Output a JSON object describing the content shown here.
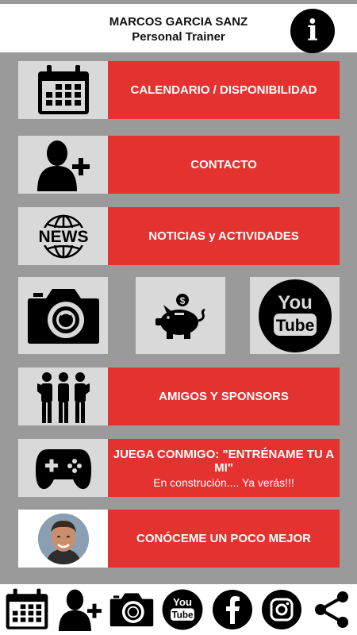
{
  "header": {
    "name": "MARCOS GARCIA SANZ",
    "role": "Personal Trainer"
  },
  "menu": {
    "calendar": "CALENDARIO / DISPONIBILIDAD",
    "contact": "CONTACTO",
    "news": "NOTICIAS y ACTIVIDADES",
    "news_icon_text": "NEWS",
    "friends": "AMIGOS Y SPONSORS",
    "game_title": "JUEGA CONMIGO: \"ENTRÉNAME TU A MI\"",
    "game_sub": "En construción.... Ya verás!!!",
    "about": "CONÓCEME UN POCO MEJOR"
  },
  "youtube": {
    "you": "You",
    "tube": "Tube"
  },
  "colors": {
    "accent": "#e3322f",
    "tile": "#d9d9d9",
    "background": "#9a9a9a"
  },
  "icons": [
    "info-icon",
    "calendar-icon",
    "add-contact-icon",
    "news-globe-icon",
    "camera-icon",
    "piggy-bank-icon",
    "youtube-icon",
    "friends-icon",
    "gamepad-icon",
    "avatar-photo",
    "facebook-icon",
    "instagram-icon",
    "share-icon"
  ]
}
